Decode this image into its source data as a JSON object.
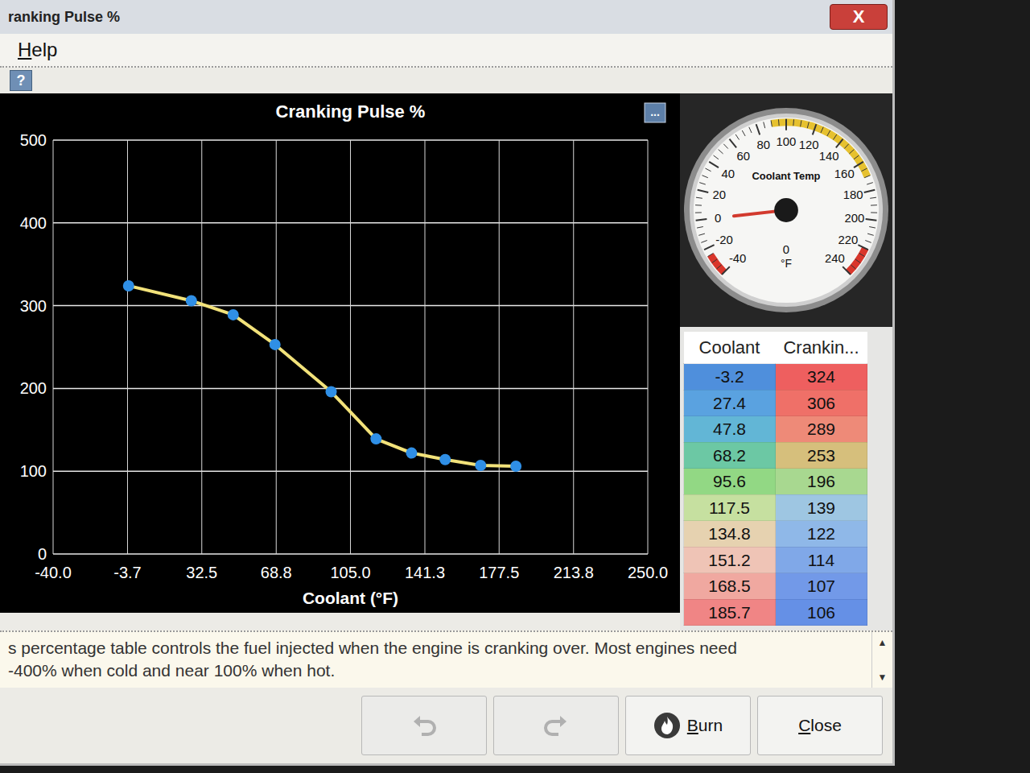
{
  "window": {
    "title": "ranking Pulse %",
    "close": "X"
  },
  "menu": [
    {
      "label": "Help"
    }
  ],
  "help_button": "?",
  "chart": {
    "title": "Cranking Pulse %",
    "options_button": "...",
    "x_label": "Coolant (°F)",
    "x_ticks": [
      "-40.0",
      "-3.7",
      "32.5",
      "68.8",
      "105.0",
      "141.3",
      "177.5",
      "213.8",
      "250.0"
    ],
    "y_ticks": [
      "500",
      "400",
      "300",
      "200",
      "100",
      "0"
    ],
    "x_min": -40,
    "x_max": 250,
    "y_min": 0,
    "y_max": 500,
    "series": [
      {
        "x": [
          -3.2,
          27.4,
          47.8,
          68.2,
          95.6,
          117.5,
          134.8,
          151.2,
          168.5,
          185.7
        ],
        "y": [
          324,
          306,
          289,
          253,
          196,
          139,
          122,
          114,
          107,
          106
        ],
        "color": "#f2e27a"
      }
    ]
  },
  "gauge": {
    "title": "Coolant Temp",
    "ticks": [
      "-40",
      "-20",
      "0",
      "20",
      "40",
      "60",
      "80",
      "100",
      "120",
      "140",
      "160",
      "180",
      "200",
      "220",
      "240"
    ],
    "value": "0",
    "units": "°F",
    "level": 0.143
  },
  "table": {
    "columns": [
      "Coolant",
      "Crankin..."
    ],
    "rows": [
      {
        "coolant": "-3.2",
        "pulse": "324",
        "coolant_color": "#4f8fdc",
        "pulse_color": "#ee5f5f"
      },
      {
        "coolant": "27.4",
        "pulse": "306",
        "coolant_color": "#5aa2e0",
        "pulse_color": "#ef7068"
      },
      {
        "coolant": "47.8",
        "pulse": "289",
        "coolant_color": "#62b6d6",
        "pulse_color": "#ee8a78"
      },
      {
        "coolant": "68.2",
        "pulse": "253",
        "coolant_color": "#6cc8a4",
        "pulse_color": "#d6bf7c"
      },
      {
        "coolant": "95.6",
        "pulse": "196",
        "coolant_color": "#92d884",
        "pulse_color": "#a8d890"
      },
      {
        "coolant": "117.5",
        "pulse": "139",
        "coolant_color": "#c6e0a0",
        "pulse_color": "#9ec6e2"
      },
      {
        "coolant": "134.8",
        "pulse": "122",
        "coolant_color": "#e6d2b0",
        "pulse_color": "#8fb8e8"
      },
      {
        "coolant": "151.2",
        "pulse": "114",
        "coolant_color": "#efc4b6",
        "pulse_color": "#80a8e8"
      },
      {
        "coolant": "168.5",
        "pulse": "107",
        "coolant_color": "#f0a8a0",
        "pulse_color": "#7299e8"
      },
      {
        "coolant": "185.7",
        "pulse": "106",
        "coolant_color": "#f08585",
        "pulse_color": "#6590e6"
      }
    ]
  },
  "help_text": [
    "s percentage table controls the fuel injected when the engine is cranking over. Most engines need",
    "-400% when cold and near 100% when hot."
  ],
  "scroll": [
    "▲",
    "▼"
  ],
  "buttons": [
    {
      "kind": "undo",
      "disabled": true
    },
    {
      "kind": "redo",
      "disabled": true
    },
    {
      "kind": "burn",
      "label": "Burn",
      "disabled": false
    },
    {
      "kind": "close",
      "label": "Close",
      "disabled": false
    }
  ]
}
